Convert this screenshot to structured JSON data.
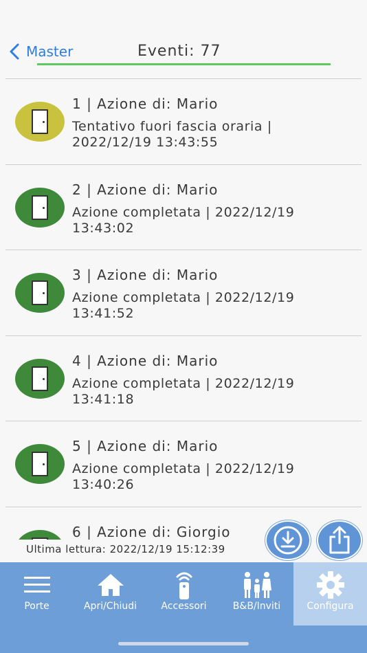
{
  "header": {
    "back_label": "Master",
    "title": "Eventi: 77"
  },
  "events": [
    {
      "title": "1 | Azione di: Mario",
      "desc": "Tentativo fuori fascia oraria | 2022/12/19 13:43:55",
      "color": "#c9c23f"
    },
    {
      "title": "2 | Azione di: Mario",
      "desc": "Azione completata | 2022/12/19 13:43:02",
      "color": "#3f8a3a"
    },
    {
      "title": "3 | Azione di: Mario",
      "desc": "Azione completata | 2022/12/19 13:41:52",
      "color": "#3f8a3a"
    },
    {
      "title": "4 | Azione di: Mario",
      "desc": "Azione completata | 2022/12/19 13:41:18",
      "color": "#3f8a3a"
    },
    {
      "title": "5 | Azione di: Mario",
      "desc": "Azione completata | 2022/12/19 13:40:26",
      "color": "#3f8a3a"
    },
    {
      "title": "6 | Azione di: Giorgio",
      "desc": "",
      "color": "#3f8a3a"
    }
  ],
  "footer": {
    "last_read": "Ultima lettura: 2022/12/19 15:12:39"
  },
  "tabs": [
    {
      "label": "Porte",
      "icon": "menu-icon"
    },
    {
      "label": "Apri/Chiudi",
      "icon": "home-icon"
    },
    {
      "label": "Accessori",
      "icon": "remote-icon"
    },
    {
      "label": "B&B/Inviti",
      "icon": "family-icon"
    },
    {
      "label": "Configura",
      "icon": "gear-icon",
      "active": true
    }
  ],
  "colors": {
    "accent": "#2f7de1",
    "underline": "#5fc95f",
    "tabbar": "#6d9ed8",
    "tab_active": "#b7d0ee"
  }
}
